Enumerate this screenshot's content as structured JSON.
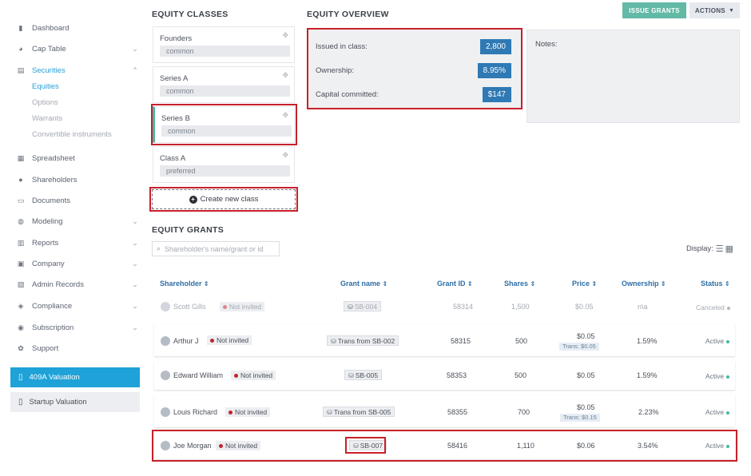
{
  "sidebar": {
    "items": [
      {
        "label": "Dashboard",
        "icon": "bar-chart-icon",
        "chevron": false
      },
      {
        "label": "Cap Table",
        "icon": "pie-chart-icon",
        "chevron": true
      },
      {
        "label": "Securities",
        "icon": "clipboard-icon",
        "chevron": true,
        "active": true
      },
      {
        "label": "Spreadsheet",
        "icon": "spreadsheet-icon",
        "chevron": false
      },
      {
        "label": "Shareholders",
        "icon": "user-icon",
        "chevron": false
      },
      {
        "label": "Documents",
        "icon": "documents-icon",
        "chevron": false
      },
      {
        "label": "Modeling",
        "icon": "bulb-icon",
        "chevron": true
      },
      {
        "label": "Reports",
        "icon": "reports-icon",
        "chevron": true
      },
      {
        "label": "Company",
        "icon": "company-icon",
        "chevron": true
      },
      {
        "label": "Admin Records",
        "icon": "admin-records-icon",
        "chevron": true
      },
      {
        "label": "Compliance",
        "icon": "shield-icon",
        "chevron": true
      },
      {
        "label": "Subscription",
        "icon": "dollar-icon",
        "chevron": true
      },
      {
        "label": "Support",
        "icon": "support-icon",
        "chevron": false
      }
    ],
    "securities_sub": [
      "Equities",
      "Options",
      "Warrants",
      "Convertible instruments"
    ],
    "valuation_409a": "409A Valuation",
    "valuation_startup": "Startup Valuation"
  },
  "equity_classes": {
    "title": "EQUITY CLASSES",
    "classes": [
      {
        "name": "Founders",
        "type": "common"
      },
      {
        "name": "Series A",
        "type": "common"
      },
      {
        "name": "Series B",
        "type": "common"
      },
      {
        "name": "Class A",
        "type": "preferred"
      }
    ],
    "create_label": "Create new class"
  },
  "overview": {
    "title": "EQUITY OVERVIEW",
    "issued_label": "Issued in class:",
    "issued_value": "2,800",
    "ownership_label": "Ownership:",
    "ownership_value": "8.95%",
    "capital_label": "Capital committed:",
    "capital_value": "$147",
    "notes_label": "Notes:"
  },
  "toolbar": {
    "issue_grants": "ISSUE GRANTS",
    "actions": "ACTIONS"
  },
  "grants": {
    "title": "EQUITY GRANTS",
    "search_placeholder": "Shareholder's name/grant or id",
    "display_label": "Display:",
    "columns": {
      "shareholder": "Shareholder",
      "grant_name": "Grant name",
      "grant_id": "Grant ID",
      "shares": "Shares",
      "price": "Price",
      "ownership": "Ownership",
      "status": "Status"
    },
    "rows": [
      {
        "shareholder": "Scott Gills",
        "invite": "Not invited",
        "grant": "SB-004",
        "id": "58314",
        "shares": "1,500",
        "price": "$0.05",
        "trans": "",
        "ownership": "n\\a",
        "status": "Canceled"
      },
      {
        "shareholder": "Arthur J",
        "invite": "Not invited",
        "grant": "Trans from SB-002",
        "id": "58315",
        "shares": "500",
        "price": "$0.05",
        "trans": "Trans: $0.05",
        "ownership": "1.59%",
        "status": "Active"
      },
      {
        "shareholder": "Edward William",
        "invite": "Not invited",
        "grant": "SB-005",
        "id": "58353",
        "shares": "500",
        "price": "$0.05",
        "trans": "",
        "ownership": "1.59%",
        "status": "Active"
      },
      {
        "shareholder": "Louis Richard",
        "invite": "Not invited",
        "grant": "Trans from SB-005",
        "id": "58355",
        "shares": "700",
        "price": "$0.05",
        "trans": "Trans: $0.15",
        "ownership": "2.23%",
        "status": "Active"
      },
      {
        "shareholder": "Joe Morgan",
        "invite": "Not invited",
        "grant": "SB-007",
        "id": "58416",
        "shares": "1,110",
        "price": "$0.06",
        "trans": "",
        "ownership": "3.54%",
        "status": "Active"
      }
    ],
    "status_colors": {
      "Active": "#45b8a2",
      "Canceled": "#b3b8bf"
    }
  }
}
